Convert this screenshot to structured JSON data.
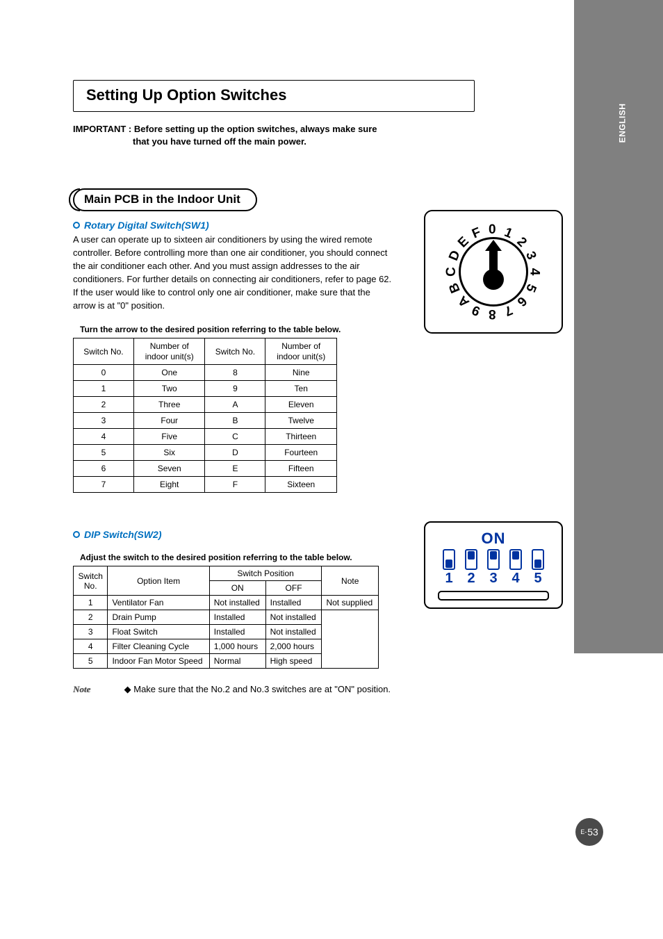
{
  "language_tab": "ENGLISH",
  "page_number": "53",
  "page_prefix": "E-",
  "title": "Setting Up Option Switches",
  "important": {
    "label": "IMPORTANT :",
    "line1": "Before setting up the option switches, always make sure",
    "line2": "that you have turned off the main power."
  },
  "section": {
    "title": "Main PCB in the Indoor Unit"
  },
  "rotary": {
    "heading": "Rotary Digital Switch(SW1)",
    "paragraph": "A user can operate up to sixteen air conditioners by using the wired remote controller. Before controlling more than one air conditioner, you should connect the air conditioner each other. And you must assign addresses to the air conditioners. For further details on connecting air conditioners, refer to page 62. If the user would like to control only one air conditioner, make sure that the arrow is at \"0\" position.",
    "caption": "Turn the arrow to the desired position referring to the table below.",
    "headers": {
      "a": "Switch No.",
      "b": "Number of\nindoor unit(s)",
      "c": "Switch No.",
      "d": "Number of\nindoor unit(s)"
    },
    "rows": [
      {
        "a": "0",
        "b": "One",
        "c": "8",
        "d": "Nine"
      },
      {
        "a": "1",
        "b": "Two",
        "c": "9",
        "d": "Ten"
      },
      {
        "a": "2",
        "b": "Three",
        "c": "A",
        "d": "Eleven"
      },
      {
        "a": "3",
        "b": "Four",
        "c": "B",
        "d": "Twelve"
      },
      {
        "a": "4",
        "b": "Five",
        "c": "C",
        "d": "Thirteen"
      },
      {
        "a": "5",
        "b": "Six",
        "c": "D",
        "d": "Fourteen"
      },
      {
        "a": "6",
        "b": "Seven",
        "c": "E",
        "d": "Fifteen"
      },
      {
        "a": "7",
        "b": "Eight",
        "c": "F",
        "d": "Sixteen"
      }
    ],
    "dial_chars": [
      "E",
      "F",
      "0",
      "1",
      "2",
      "3",
      "4",
      "5",
      "6",
      "7",
      "8",
      "9",
      "A",
      "B",
      "C",
      "D"
    ]
  },
  "dip": {
    "heading": "DIP Switch(SW2)",
    "caption": "Adjust the switch to the desired position referring to the table below.",
    "headers": {
      "no": "Switch\nNo.",
      "item": "Option Item",
      "pos": "Switch Position",
      "on": "ON",
      "off": "OFF",
      "note": "Note"
    },
    "rows": [
      {
        "no": "1",
        "item": "Ventilator Fan",
        "on": "Not installed",
        "off": "Installed",
        "note": "Not supplied"
      },
      {
        "no": "2",
        "item": "Drain Pump",
        "on": "Installed",
        "off": "Not installed",
        "note": ""
      },
      {
        "no": "3",
        "item": "Float Switch",
        "on": "Installed",
        "off": "Not installed",
        "note": ""
      },
      {
        "no": "4",
        "item": "Filter Cleaning Cycle",
        "on": "1,000 hours",
        "off": "2,000 hours",
        "note": ""
      },
      {
        "no": "5",
        "item": "Indoor Fan Motor Speed",
        "on": "Normal",
        "off": "High speed",
        "note": ""
      }
    ],
    "label_on": "ON",
    "switches": [
      {
        "num": "1",
        "state": "down"
      },
      {
        "num": "2",
        "state": "up"
      },
      {
        "num": "3",
        "state": "up"
      },
      {
        "num": "4",
        "state": "up"
      },
      {
        "num": "5",
        "state": "down"
      }
    ]
  },
  "note": {
    "label": "Note",
    "text": "Make sure that the No.2 and No.3 switches are at \"ON\" position."
  }
}
